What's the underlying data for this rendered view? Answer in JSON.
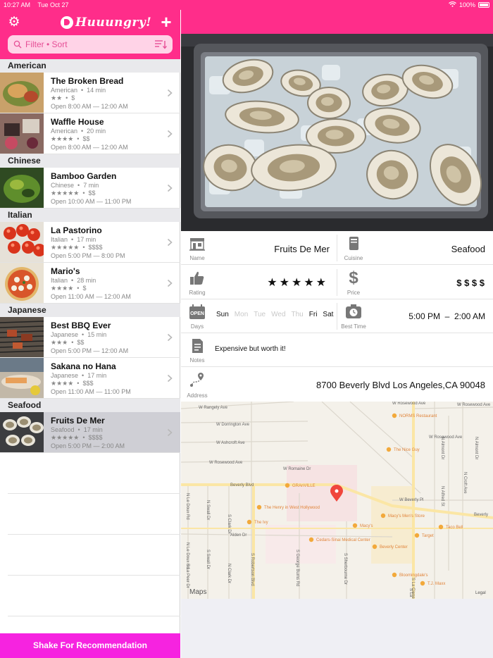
{
  "status": {
    "time": "10:27 AM",
    "date": "Tue Oct 27",
    "battery": "100%"
  },
  "app": {
    "title": "Huuungry!",
    "accent": "#ff2d8a",
    "bottom_accent": "#f623e0"
  },
  "header": {
    "settings_icon": "gear-icon",
    "add_icon": "plus-icon"
  },
  "search": {
    "placeholder": "Filter • Sort"
  },
  "sections": [
    {
      "title": "American",
      "items": [
        {
          "name": "The Broken Bread",
          "cuisine": "American",
          "time": "14 min",
          "stars": "★★",
          "price": "$",
          "hours": "Open 8:00 AM — 12:00 AM",
          "thumb": "bread"
        },
        {
          "name": "Waffle House",
          "cuisine": "American",
          "time": "20 min",
          "stars": "★★★★",
          "price": "$$",
          "hours": "Open 8:00 AM — 12:00 AM",
          "thumb": "waffle"
        }
      ]
    },
    {
      "title": "Chinese",
      "items": [
        {
          "name": "Bamboo Garden",
          "cuisine": "Chinese",
          "time": "7 min",
          "stars": "★★★★★",
          "price": "$$",
          "hours": "Open 10:00 AM — 11:00 PM",
          "thumb": "greens"
        }
      ]
    },
    {
      "title": "Italian",
      "items": [
        {
          "name": "La Pastorino",
          "cuisine": "Italian",
          "time": "17 min",
          "stars": "★★★★★",
          "price": "$$$$",
          "hours": "Open 5:00 PM — 8:00 PM",
          "thumb": "tomato"
        },
        {
          "name": "Mario's",
          "cuisine": "Italian",
          "time": "28 min",
          "stars": "★★★★",
          "price": "$",
          "hours": "Open 11:00 AM — 12:00 AM",
          "thumb": "pizza"
        }
      ]
    },
    {
      "title": "Japanese",
      "items": [
        {
          "name": "Best BBQ Ever",
          "cuisine": "Japanese",
          "time": "15 min",
          "stars": "★★★",
          "price": "$$",
          "hours": "Open 5:00 PM — 12:00 AM",
          "thumb": "bbq"
        },
        {
          "name": "Sakana no Hana",
          "cuisine": "Japanese",
          "time": "17 min",
          "stars": "★★★★",
          "price": "$$$",
          "hours": "Open 11:00 AM — 11:00 PM",
          "thumb": "fish"
        }
      ]
    },
    {
      "title": "Seafood",
      "items": [
        {
          "name": "Fruits De Mer",
          "cuisine": "Seafood",
          "time": "17 min",
          "stars": "★★★★★",
          "price": "$$$$",
          "hours": "Open 5:00 PM — 2:00 AM",
          "thumb": "oyster",
          "selected": true
        }
      ]
    }
  ],
  "bottom": {
    "label": "Shake For Recommendation"
  },
  "detail": {
    "name_label": "Name",
    "name": "Fruits De Mer",
    "cuisine_label": "Cuisine",
    "cuisine": "Seafood",
    "rating_label": "Rating",
    "rating": "★★★★★",
    "price_label": "Price",
    "price": "$ $ $ $",
    "days_label": "Days",
    "days": [
      {
        "d": "Sun",
        "on": true
      },
      {
        "d": "Mon",
        "on": false
      },
      {
        "d": "Tue",
        "on": false
      },
      {
        "d": "Wed",
        "on": false
      },
      {
        "d": "Thu",
        "on": false
      },
      {
        "d": "Fri",
        "on": true
      },
      {
        "d": "Sat",
        "on": true
      }
    ],
    "best_time_label": "Best Time",
    "best_time": "5:00 PM  –  2:00 AM",
    "notes_label": "Notes",
    "notes": "Expensive but worth it!",
    "address_label": "Address",
    "address": "8700 Beverly Blvd Los Angeles,CA 90048"
  },
  "map": {
    "streets": [
      "W Rangely Ave",
      "W Dorrington Ave",
      "W Ashcroft Ave",
      "W Rosewood Ave",
      "W Rosewood Ave",
      "W Rosewood Ave",
      "W Rosewood Ave",
      "Beverly Blvd",
      "Beverly",
      "W Beverly Pl",
      "Alden Dr",
      "N Le Doux Rd",
      "N Le Doux Rd",
      "N Almont Dr",
      "N Almont Dr",
      "N Swall Dr",
      "N Clark Dr",
      "S Robertson Blvd",
      "S George Burns Rd",
      "S Sherbourne Dr",
      "S La Cienega",
      "N Alfred St",
      "N Croft Ave",
      "S La Peer Dr",
      "S Swall Dr",
      "S Clark Dr",
      "W Romaine Dr",
      "S La"
    ],
    "pois": [
      "NORMS Restaurant",
      "The Nice Guy",
      "GRAnVILLE",
      "The Henry in West Hollywood",
      "The Ivy",
      "Cedars-Sinai Medical Center",
      "Macy's",
      "Macy's Men's Store",
      "Beverly Center",
      "Target",
      "Taco Bell",
      "Bloomingdale's",
      "T.J. Maxx"
    ],
    "attribution": "Maps",
    "legal": "Legal"
  }
}
